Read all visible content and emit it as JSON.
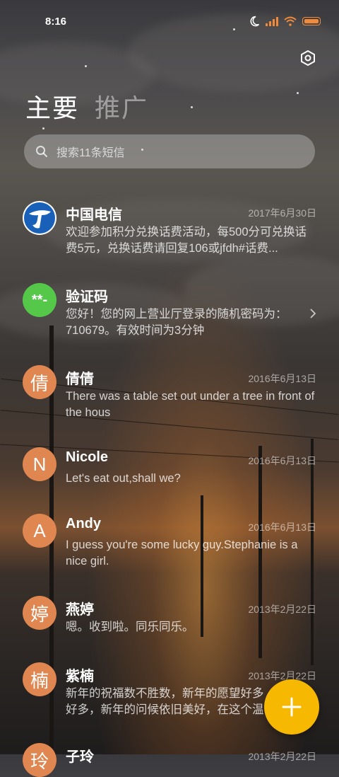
{
  "status_bar": {
    "time": "8:16"
  },
  "tabs": [
    {
      "label": "主要",
      "active": true
    },
    {
      "label": "推广",
      "active": false
    }
  ],
  "search": {
    "placeholder": "搜索11条短信"
  },
  "messages": [
    {
      "name": "中国电信",
      "date": "2017年6月30日",
      "avatar_type": "logo",
      "avatar_icon": "china-telecom-logo",
      "preview": "欢迎参加积分兑换话费活动，每500分可兑换话费5元，兑换话费请回复106或jfdh#话费..."
    },
    {
      "name": "验证码",
      "date": "",
      "avatar_type": "code",
      "avatar_text": "**-",
      "preview": "您好！您的网上营业厅登录的随机密码为：710679。有效时间为3分钟",
      "has_chevron": true
    },
    {
      "name": "倩倩",
      "date": "2016年6月13日",
      "avatar_text": "倩",
      "preview": "There was a table set out under a tree in front of the hous"
    },
    {
      "name": "Nicole",
      "date": "2016年6月13日",
      "avatar_text": "N",
      "preview": "Let's eat out,shall we?"
    },
    {
      "name": "Andy",
      "date": "2016年6月13日",
      "avatar_text": "A",
      "preview": "I guess you're some lucky guy.Stephanie is a nice girl."
    },
    {
      "name": "燕婷",
      "date": "2013年2月22日",
      "avatar_text": "婷",
      "preview": "嗯。收到啦。同乐同乐。"
    },
    {
      "name": "紫楠",
      "date": "2013年2月22日",
      "avatar_text": "楠",
      "preview": "新年的祝福数不胜数，新年的愿望好多好多，新年的问候依旧美好，在这个温馨的..."
    },
    {
      "name": "子玲",
      "date": "2013年2月22日",
      "avatar_text": "玲",
      "preview": ""
    }
  ],
  "colors": {
    "accent_fab": "#f6b800",
    "avatar_orange": "#e08650",
    "avatar_green": "#55c84a",
    "status_orange": "#f28a3c"
  },
  "icons": {
    "settings": "settings-hex-icon",
    "search": "search-icon",
    "fab": "plus-icon"
  }
}
